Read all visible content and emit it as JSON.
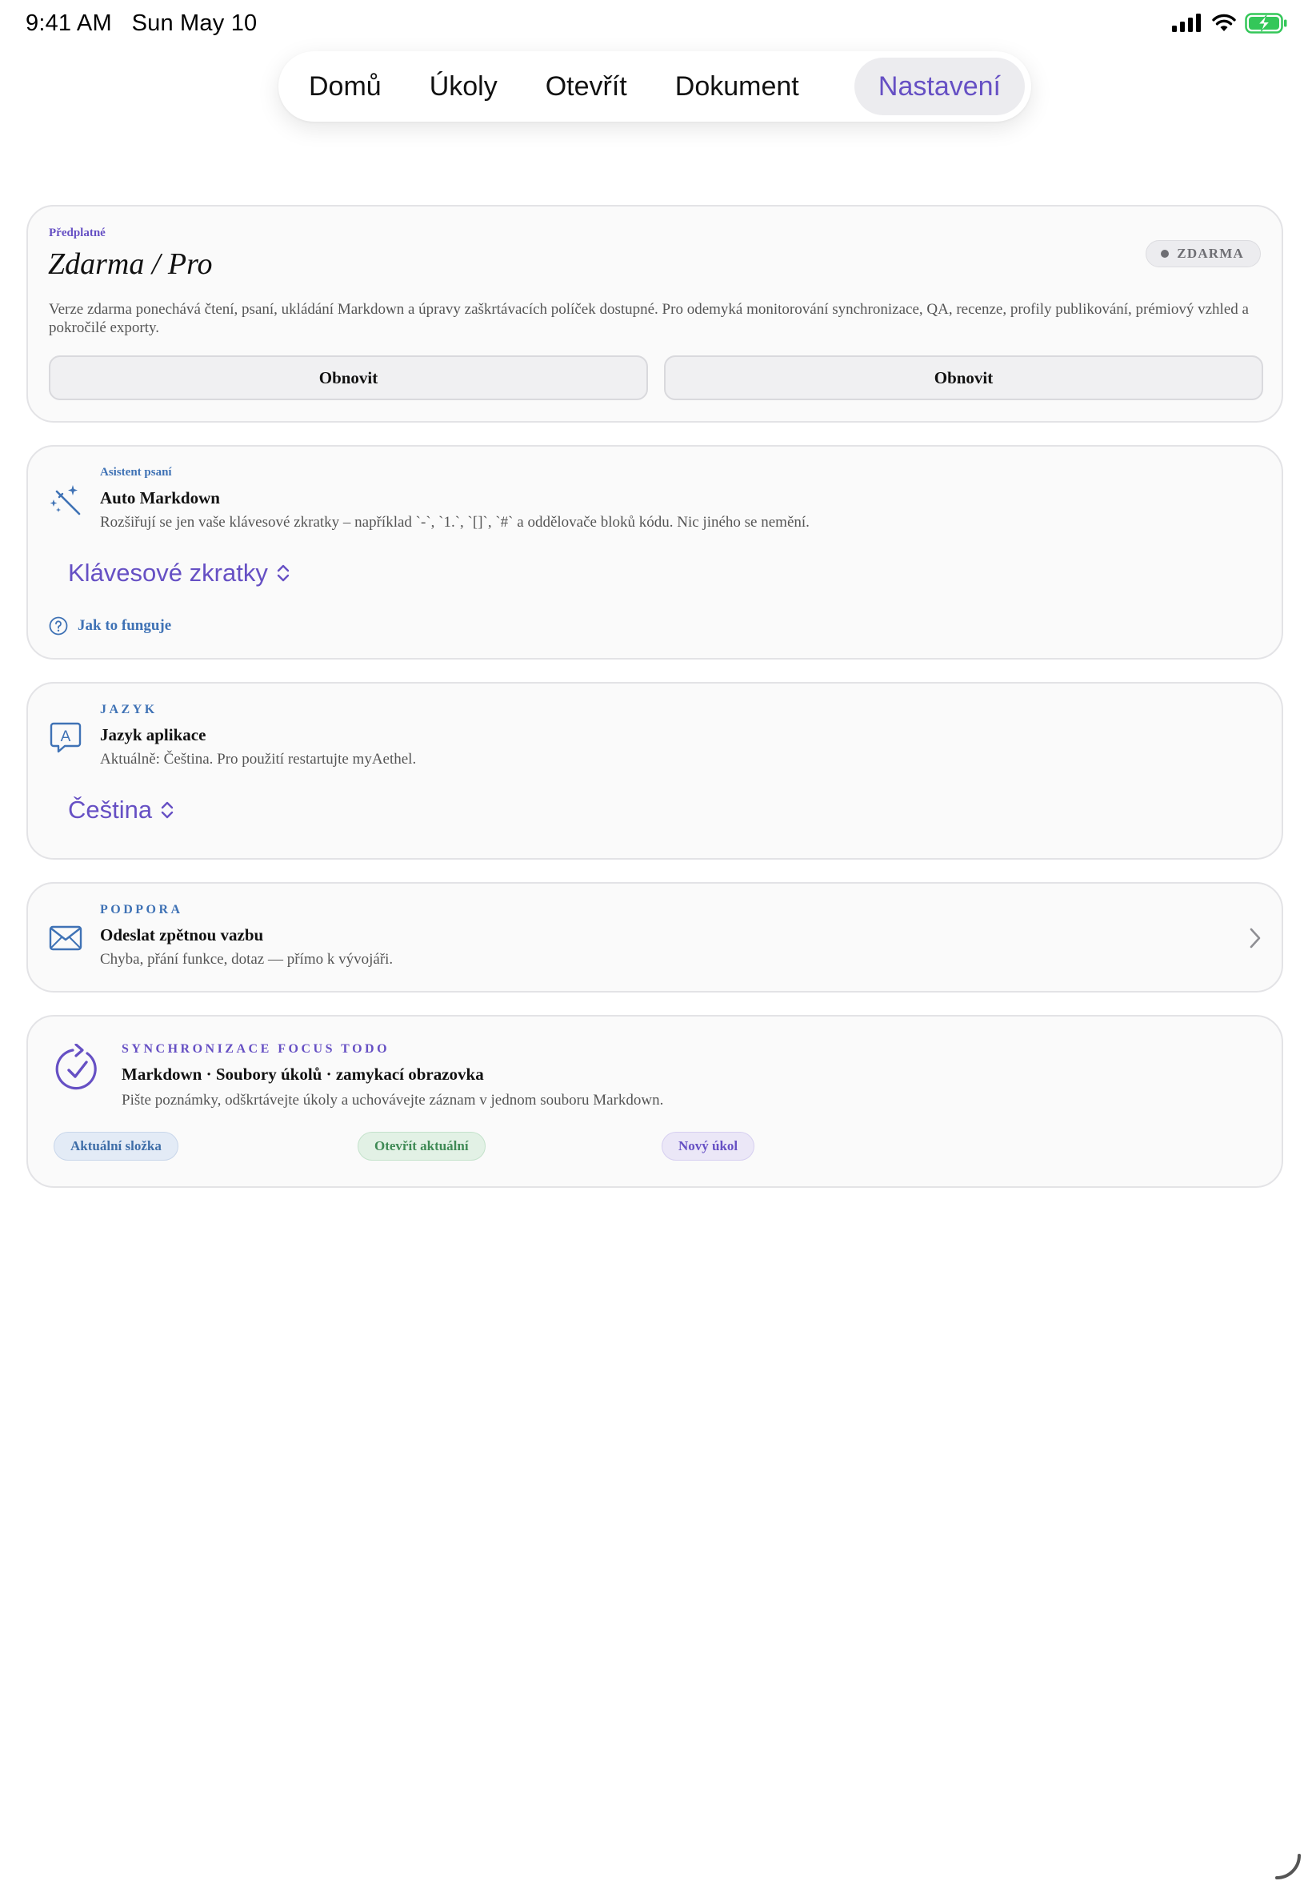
{
  "status_bar": {
    "time": "9:41 AM",
    "date": "Sun May 10",
    "icons": [
      "cellular-signal-icon",
      "wifi-icon",
      "battery-charging-icon"
    ]
  },
  "tabs": [
    {
      "label": "Domů",
      "active": false
    },
    {
      "label": "Úkoly",
      "active": false
    },
    {
      "label": "Otevřít",
      "active": false
    },
    {
      "label": "Dokument",
      "active": false
    },
    {
      "label": "Nastavení",
      "active": true
    }
  ],
  "subscription": {
    "section_label": "Předplatné",
    "title": "Zdarma / Pro",
    "badge": "ZDARMA",
    "description": "Verze zdarma ponechává čtení, psaní, ukládání Markdown a úpravy zaškrtávacích políček dostupné. Pro odemyká monitorování synchronizace, QA, recenze, profily publikování, prémiový vzhled a pokročilé exporty.",
    "buttons": [
      "Obnovit",
      "Obnovit"
    ]
  },
  "writing_assistant": {
    "kicker": "Asistent psaní",
    "title": "Auto Markdown",
    "description": "Rozšiřují se jen vaše klávesové zkratky – například `-`, `1.`, `[]`, `#` a oddělovače bloků kódu. Nic jiného se nemění.",
    "picker_value": "Klávesové zkratky",
    "help_link": "Jak to funguje",
    "icon": "magic-wand-icon"
  },
  "language": {
    "kicker": "JAZYK",
    "title": "Jazyk aplikace",
    "description": "Aktuálně: Čeština. Pro použití restartujte myAethel.",
    "picker_value": "Čeština",
    "icon": "character-bubble-icon"
  },
  "support": {
    "kicker": "PODPORA",
    "title": "Odeslat zpětnou vazbu",
    "description": "Chyba, přání funkce, dotaz — přímo k vývojáři.",
    "icon": "envelope-icon"
  },
  "focus_sync": {
    "kicker": "SYNCHRONIZACE FOCUS TODO",
    "title": "Markdown · Soubory úkolů · zamykací obrazovka",
    "description": "Pište poznámky, odškrtávejte úkoly a uchovávejte záznam v jednom souboru Markdown.",
    "pills": [
      "Aktuální složka",
      "Otevřít aktuální",
      "Nový úkol"
    ],
    "icon": "sync-check-icon"
  },
  "colors": {
    "accent": "#6650c4",
    "link_blue": "#3f72b5",
    "battery_green": "#34c759"
  }
}
